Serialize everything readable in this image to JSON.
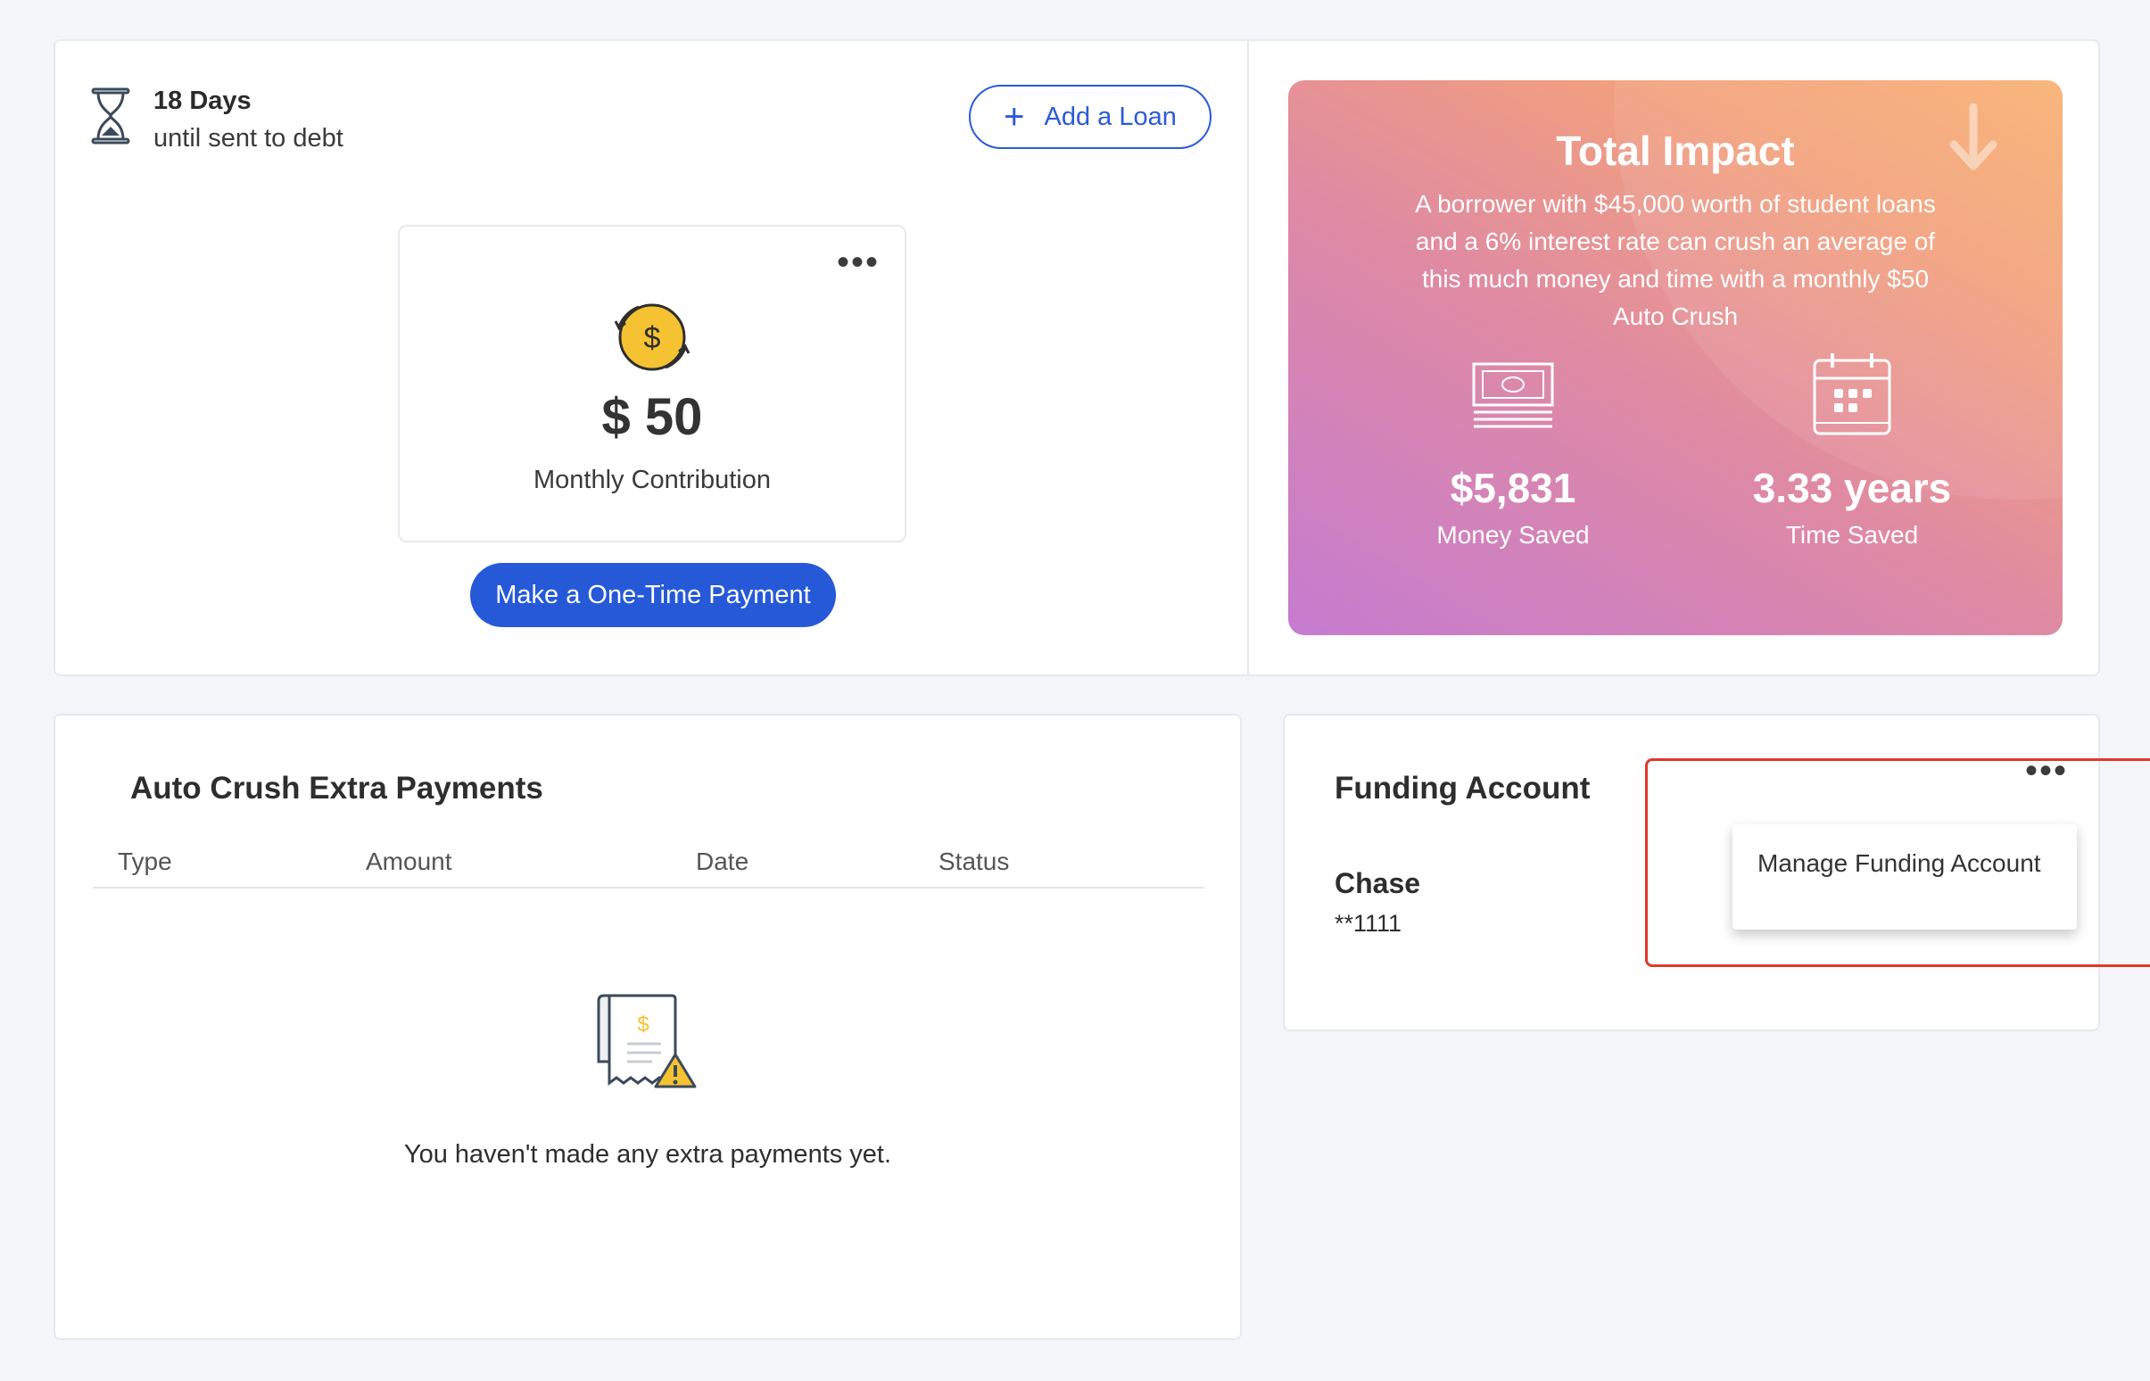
{
  "countdown": {
    "days": "18 Days",
    "subtitle": "until sent to debt"
  },
  "actions": {
    "add_loan": "Add a Loan",
    "add_loan_icon": "plus-icon",
    "one_time_payment": "Make a One-Time Payment"
  },
  "contribution": {
    "amount": "$ 50",
    "label": "Monthly Contribution",
    "menu_icon": "more-dots-icon",
    "icon": "recurring-dollar-coin-icon"
  },
  "impact": {
    "title": "Total Impact",
    "description": "A borrower with $45,000 worth of student loans and a 6% interest rate can crush an average of this much money and time with a monthly $50 Auto Crush",
    "money_value": "$5,831",
    "money_label": "Money Saved",
    "time_value": "3.33 years",
    "time_label": "Time Saved",
    "colors": {
      "gradient_start": "#c57bd0",
      "gradient_end": "#f9b070"
    }
  },
  "payments": {
    "title": "Auto Crush Extra Payments",
    "columns": [
      "Type",
      "Amount",
      "Date",
      "Status"
    ],
    "rows": [],
    "empty_text": "You haven't made any extra payments yet."
  },
  "funding": {
    "title": "Funding Account",
    "bank": "Chase",
    "account": "**1111",
    "menu": {
      "items": [
        "Manage Funding Account"
      ]
    }
  },
  "colors": {
    "primary": "#2559d8",
    "highlight": "#e0392b",
    "coin": "#f5c232"
  }
}
